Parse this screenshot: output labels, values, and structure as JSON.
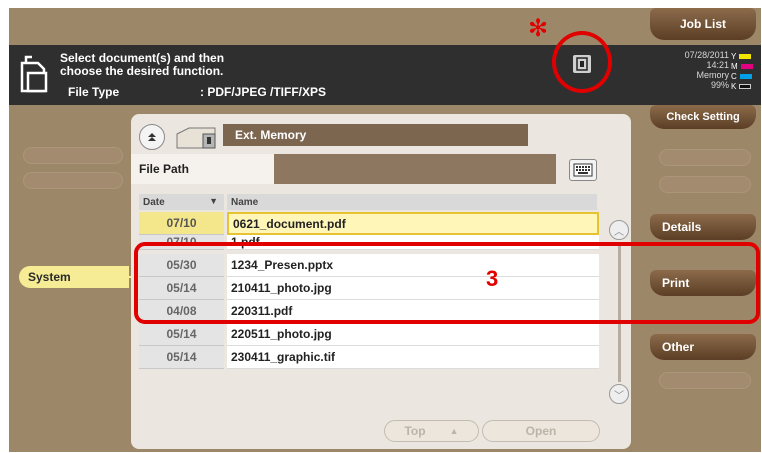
{
  "header": {
    "message_line1": "Select document(s) and then",
    "message_line2": "choose the desired function.",
    "file_type_label": "File Type",
    "file_type_value": ": PDF/JPEG /TIFF/XPS",
    "date": "07/28/2011",
    "time": "14:21",
    "memory_label": "Memory",
    "memory_value": "99%",
    "toner": [
      {
        "label": "Y",
        "color": "#f2e500"
      },
      {
        "label": "M",
        "color": "#e5007f"
      },
      {
        "label": "C",
        "color": "#00a0e9"
      },
      {
        "label": "K",
        "color": "#111111"
      }
    ]
  },
  "right_buttons": {
    "job_list": "Job List",
    "check_setting": "Check Setting",
    "details": "Details",
    "print": "Print",
    "other": "Other"
  },
  "left_tab": {
    "system": "System"
  },
  "panel": {
    "location": "Ext. Memory",
    "file_path_label": "File Path",
    "columns": {
      "date": "Date",
      "name": "Name"
    },
    "files": [
      {
        "date": "07/10",
        "name": "0621_document.pdf",
        "selected": true
      },
      {
        "date": "07/10",
        "name": "1.pdf"
      },
      {
        "date": "05/30",
        "name": "1234_Presen.pptx"
      },
      {
        "date": "05/14",
        "name": "210411_photo.jpg"
      },
      {
        "date": "04/08",
        "name": "220311.pdf"
      },
      {
        "date": "05/14",
        "name": "220511_photo.jpg"
      },
      {
        "date": "05/14",
        "name": "230411_graphic.tif"
      }
    ],
    "top_button": "Top",
    "open_button": "Open"
  },
  "annotations": {
    "asterisk": "✻",
    "number": "3",
    "color": "#e00000"
  }
}
